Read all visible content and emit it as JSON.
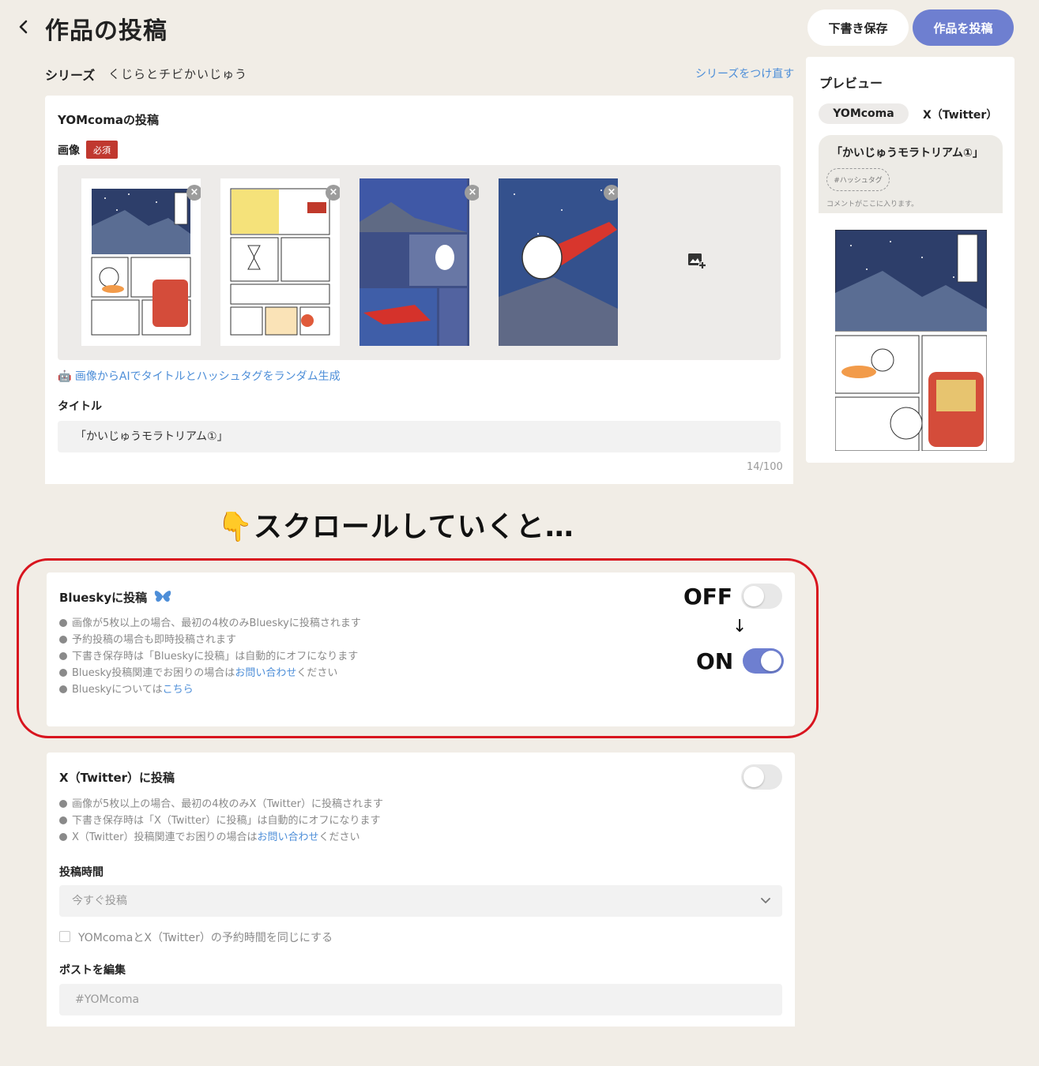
{
  "header": {
    "page_title": "作品の投稿",
    "draft_button": "下書き保存",
    "post_button": "作品を投稿"
  },
  "series": {
    "label": "シリーズ",
    "name": "くじらとチビかいじゅう",
    "reattach_link": "シリーズをつけ直す"
  },
  "yomcoma": {
    "section_title": "YOMcomaの投稿",
    "image_label": "画像",
    "required_badge": "必須",
    "ai_generate_link": "画像からAIでタイトルとハッシュタグをランダム生成",
    "title_label": "タイトル",
    "title_value": "「かいじゅうモラトリアム①」",
    "char_count": "14/100"
  },
  "annotation": {
    "scroll_note": "👇スクロールしていくと…",
    "off_label": "OFF",
    "arrow": "↓",
    "on_label": "ON"
  },
  "bluesky": {
    "section_title": "Blueskyに投稿",
    "bullets": [
      "画像が5枚以上の場合、最初の4枚のみBlueskyに投稿されます",
      "予約投稿の場合も即時投稿されます",
      "下書き保存時は「Blueskyに投稿」は自動的にオフになります"
    ],
    "bullet_help_prefix": "Bluesky投稿関連でお困りの場合は",
    "bullet_help_link": "お問い合わせ",
    "bullet_help_suffix": "ください",
    "bullet_about_prefix": "Blueskyについては",
    "bullet_about_link": "こちら",
    "toggle_on": true
  },
  "x_twitter": {
    "section_title": "X（Twitter）に投稿",
    "bullets": [
      "画像が5枚以上の場合、最初の4枚のみX（Twitter）に投稿されます",
      "下書き保存時は「X（Twitter）に投稿」は自動的にオフになります"
    ],
    "bullet_help_prefix": "X（Twitter）投稿関連でお困りの場合は",
    "bullet_help_link": "お問い合わせ",
    "bullet_help_suffix": "ください",
    "toggle_on": false,
    "post_time_label": "投稿時間",
    "post_time_value": "今すぐ投稿",
    "sync_checkbox_label": "YOMcomaとX（Twitter）の予約時間を同じにする",
    "sync_checked": false,
    "edit_post_label": "ポストを編集",
    "edit_post_placeholder": "#YOMcoma"
  },
  "preview": {
    "title": "プレビュー",
    "tabs": [
      "YOMcoma",
      "X（Twitter）"
    ],
    "active_tab": "YOMcoma",
    "work_title": "「かいじゅうモラトリアム①」",
    "hashtag_placeholder": "#ハッシュタグ",
    "comment_placeholder": "コメントがここに入ります。"
  },
  "colors": {
    "background": "#f1ede6",
    "accent": "#6e7fd0",
    "link": "#4d8ed8",
    "required": "#c0382f",
    "annotation_outline": "#d8141e"
  },
  "icons": {
    "back": "chevron-left-icon",
    "remove": "close-circle-icon",
    "add_image": "add-photo-icon",
    "ai": "robot-icon",
    "bluesky": "butterfly-icon",
    "select": "chevron-down-icon"
  }
}
